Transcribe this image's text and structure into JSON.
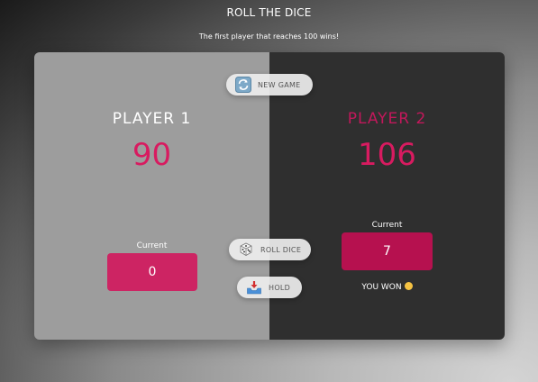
{
  "header": {
    "title": "ROLL THE DICE",
    "subtitle": "The first player that reaches 100 wins!"
  },
  "players": [
    {
      "name": "PLAYER 1",
      "score": "90",
      "current_label": "Current",
      "current": "0",
      "active": false
    },
    {
      "name": "PLAYER 2",
      "score": "106",
      "current_label": "Current",
      "current": "7",
      "active": true,
      "status": "YOU WON"
    }
  ],
  "buttons": {
    "new_game": "NEW GAME",
    "roll_dice": "ROLL DICE",
    "hold": "HOLD"
  },
  "icons": {
    "new_game": "refresh-icon",
    "roll_dice": "dice-icon",
    "hold": "inbox-tray-icon",
    "won": "face-emoji-icon"
  },
  "colors": {
    "accent": "#d81b60",
    "player1_panel": "#9d9d9d",
    "player2_panel": "#2f2f2f",
    "current_box_1": "#cd2463",
    "current_box_2": "#b6114f"
  }
}
